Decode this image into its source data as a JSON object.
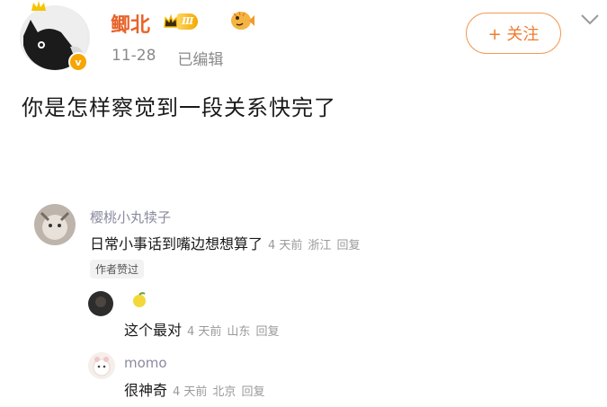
{
  "post": {
    "author": "鲫北",
    "vip_level": "Ⅲ",
    "verified_mark": "v",
    "date": "11-28",
    "edited": "已编辑",
    "follow_label": "+ 关注",
    "text": "你是怎样察觉到一段关系快完了"
  },
  "comments": [
    {
      "name": "樱桃小丸犊子",
      "text": "日常小事话到嘴边想想算了",
      "time": "4 天前",
      "location": "浙江",
      "reply": "回复",
      "badge": "作者赞过"
    },
    {
      "name": "",
      "text": "这个最对",
      "time": "4 天前",
      "location": "山东",
      "reply": "回复"
    },
    {
      "name": "momo",
      "text": "很神奇",
      "time": "4 天前",
      "location": "北京",
      "reply": "回复"
    }
  ],
  "colors": {
    "author_name": "#e8632a",
    "follow_border": "#f29a55",
    "comment_name": "#8a8aa0"
  },
  "icons": [
    "cat-avatar-icon",
    "crown-icon",
    "fish-icon",
    "chevron-down-icon",
    "lemon-icon",
    "verified-icon"
  ]
}
